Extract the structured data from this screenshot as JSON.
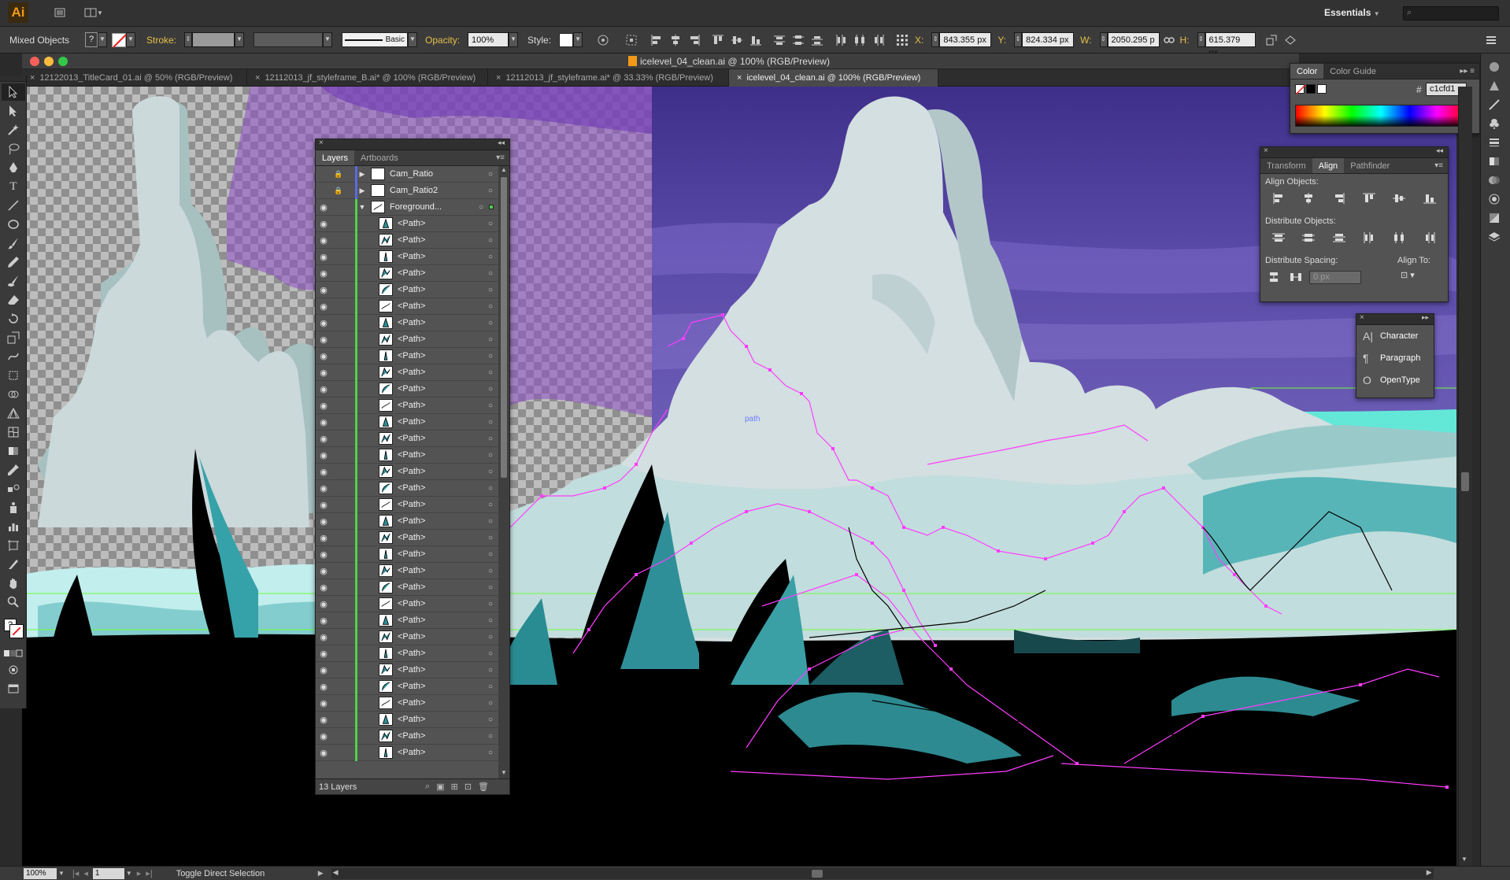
{
  "app": {
    "logo": "Ai",
    "workspace": "Essentials",
    "search_placeholder": ""
  },
  "control_bar": {
    "selection_label": "Mixed Objects",
    "fill_value": "?",
    "stroke_label": "Stroke:",
    "brush_label": "Basic",
    "opacity_label": "Opacity:",
    "opacity_value": "100%",
    "style_label": "Style:",
    "x_label": "X:",
    "x_value": "843.355 px",
    "y_label": "Y:",
    "y_value": "824.334 px",
    "w_label": "W:",
    "w_value": "2050.295 p",
    "h_label": "H:",
    "h_value": "615.379 px"
  },
  "document": {
    "window_title": "icelevel_04_clean.ai @ 100% (RGB/Preview)",
    "tabs": [
      {
        "label": "12122013_TitleCard_01.ai @ 50% (RGB/Preview)",
        "active": false
      },
      {
        "label": "12112013_jf_styleframe_B.ai* @ 100% (RGB/Preview)",
        "active": false
      },
      {
        "label": "12112013_jf_styleframe.ai* @ 33.33% (RGB/Preview)",
        "active": false
      },
      {
        "label": "icelevel_04_clean.ai @ 100% (RGB/Preview)",
        "active": true
      }
    ],
    "path_hint": "path"
  },
  "layers_panel": {
    "tabs": [
      "Layers",
      "Artboards"
    ],
    "rows": [
      {
        "name": "Cam_Ratio",
        "visible": false,
        "locked": true,
        "expanded": false,
        "bar": "#5a6be0"
      },
      {
        "name": "Cam_Ratio2",
        "visible": false,
        "locked": true,
        "expanded": false,
        "bar": "#5a6be0"
      },
      {
        "name": "Foreground...",
        "visible": true,
        "locked": false,
        "expanded": true,
        "bar": "#4fd14f"
      },
      {
        "name": "<Path>"
      },
      {
        "name": "<Path>"
      },
      {
        "name": "<Path>"
      },
      {
        "name": "<Path>"
      },
      {
        "name": "<Path>"
      },
      {
        "name": "<Path>"
      },
      {
        "name": "<Path>"
      },
      {
        "name": "<Path>"
      },
      {
        "name": "<Path>"
      },
      {
        "name": "<Path>"
      },
      {
        "name": "<Path>"
      },
      {
        "name": "<Path>"
      },
      {
        "name": "<Path>"
      },
      {
        "name": "<Path>"
      },
      {
        "name": "<Path>"
      },
      {
        "name": "<Path>"
      },
      {
        "name": "<Path>"
      },
      {
        "name": "<Path>"
      },
      {
        "name": "<Path>"
      },
      {
        "name": "<Path>"
      },
      {
        "name": "<Path>"
      },
      {
        "name": "<Path>"
      },
      {
        "name": "<Path>"
      },
      {
        "name": "<Path>"
      },
      {
        "name": "<Path>"
      },
      {
        "name": "<Path>"
      },
      {
        "name": "<Path>"
      },
      {
        "name": "<Path>"
      },
      {
        "name": "<Path>"
      },
      {
        "name": "<Path>"
      },
      {
        "name": "<Path>"
      },
      {
        "name": "<Path>"
      },
      {
        "name": "<Path>"
      }
    ],
    "footer_count": "13 Layers"
  },
  "color_panel": {
    "tabs": [
      "Color",
      "Color Guide"
    ],
    "hex_label": "#",
    "hex_value": "c1cfd1"
  },
  "align_panel": {
    "tabs": [
      "Transform",
      "Align",
      "Pathfinder"
    ],
    "align_objects": "Align Objects:",
    "distribute_objects": "Distribute Objects:",
    "distribute_spacing": "Distribute Spacing:",
    "align_to": "Align To:",
    "spacing_value": "0 px"
  },
  "char_panel": {
    "items": [
      "Character",
      "Paragraph",
      "OpenType"
    ]
  },
  "status": {
    "zoom": "100%",
    "page": "1",
    "tool_hint": "Toggle Direct Selection"
  },
  "colors": {
    "sky": "#4a3f96",
    "ice_light": "#d2dfe0",
    "ice_mid": "#b7cbcc",
    "teal": "#3b9ea6",
    "water": "#b8fbf7",
    "dark": "#000000",
    "selection": "#ff3dff",
    "guide": "#6dff3a"
  }
}
